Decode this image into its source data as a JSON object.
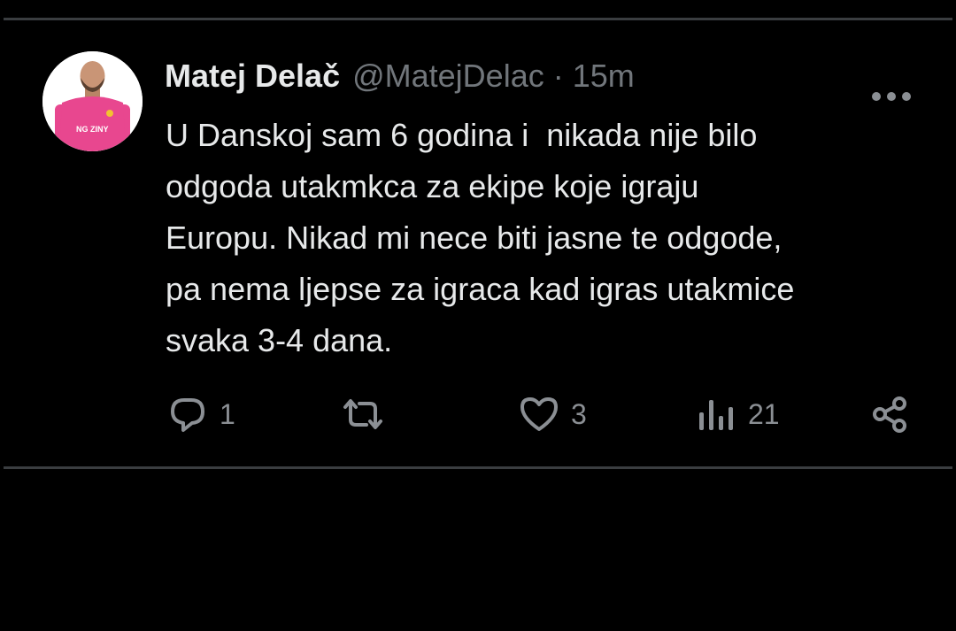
{
  "tweet": {
    "author": {
      "display_name": "Matej Delač",
      "handle": "@MatejDelac",
      "separator": "·",
      "time": "15m"
    },
    "text": "U Danskoj sam 6 godina i  nikada nije bilo\nodgoda utakmkca za ekipe koje igraju\nEuropu. Nikad mi nece biti jasne te odgode,\npa nema ljepse za igraca kad igras utakmice\nsvaka 3-4 dana.",
    "avatar": {
      "shirt_color": "#e8478f",
      "jersey_text": "NG ZINY"
    },
    "actions": {
      "reply": {
        "icon": "reply-icon",
        "count": "1"
      },
      "retweet": {
        "icon": "retweet-icon",
        "count": ""
      },
      "like": {
        "icon": "heart-icon",
        "count": "3"
      },
      "views": {
        "icon": "views-icon",
        "count": "21"
      },
      "share": {
        "icon": "share-icon"
      }
    },
    "more_icon": "more-icon"
  },
  "theme": {
    "background": "#000000",
    "text": "#e7e9ea",
    "secondary": "#71767b",
    "icon": "#8b8f94",
    "divider": "#3a3d40"
  }
}
